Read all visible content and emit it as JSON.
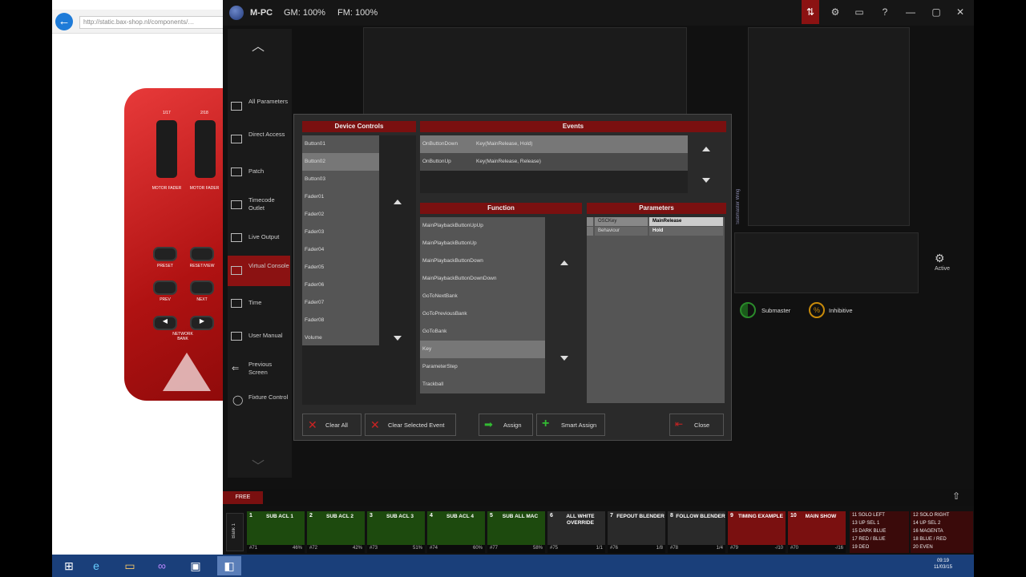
{
  "browser": {
    "url": "http://static.bax-shop.nl/components/…",
    "device_labels": {
      "fader1": "1/17",
      "fader2": "2/18",
      "fader1_label": "MOTOR FADER",
      "fader2_label": "MOTOR FADER",
      "pad1": "PRESET",
      "pad2": "RESET/VIEW",
      "pad3": "PREV",
      "pad4": "NEXT",
      "transport_label": "NETWORK BANK"
    }
  },
  "app": {
    "title": "M-PC",
    "gm": "GM: 100%",
    "fm": "FM: 100%",
    "window_buttons": [
      "⚙",
      "▭",
      "?",
      "—",
      "▢",
      "✕"
    ]
  },
  "sidemenu": {
    "items": [
      {
        "label": "All Parameters",
        "icon": "parameters-icon"
      },
      {
        "label": "Direct Access",
        "icon": "direct-access-icon"
      },
      {
        "label": "Patch",
        "icon": "patch-icon"
      },
      {
        "label": "Timecode Outlet",
        "icon": "timecode-icon"
      },
      {
        "label": "Live Output",
        "icon": "live-output-icon"
      },
      {
        "label": "Virtual Console",
        "icon": "virtual-console-icon"
      },
      {
        "label": "Time",
        "icon": "time-icon"
      },
      {
        "label": "User Manual",
        "icon": "manual-icon"
      },
      {
        "label": "Previous Screen",
        "icon": "arrow-left-icon"
      },
      {
        "label": "Fixture Control",
        "icon": "bulb-icon"
      }
    ],
    "active_index": 5
  },
  "dialog": {
    "device_controls_header": "Device Controls",
    "device_controls": [
      "Button01",
      "Button02",
      "Button03",
      "Fader01",
      "Fader02",
      "Fader03",
      "Fader04",
      "Fader05",
      "Fader06",
      "Fader07",
      "Fader08",
      "Volume"
    ],
    "selected_device_control": 1,
    "events_header": "Events",
    "events": [
      {
        "event": "OnButtonDown",
        "action": "Key(MainRelease, Hold)"
      },
      {
        "event": "OnButtonUp",
        "action": "Key(MainRelease, Release)"
      }
    ],
    "selected_event": 0,
    "function_header": "Function",
    "functions": [
      "MainPlaybackButtonUpUp",
      "MainPlaybackButtonUp",
      "MainPlaybackButtonDown",
      "MainPlaybackButtonDownDown",
      "GoToNextBank",
      "GoToPreviousBank",
      "GoToBank",
      "Key",
      "ParameterStep",
      "Trackball"
    ],
    "selected_function": 7,
    "parameters_header": "Parameters",
    "parameters": [
      {
        "name": "OSCKey",
        "value": "MainRelease"
      },
      {
        "name": "Behaviour",
        "value": "Hold"
      }
    ],
    "buttons": {
      "clear_all": "Clear All",
      "clear_selected": "Clear Selected Event",
      "assign": "Assign",
      "smart_assign": "Smart Assign",
      "close": "Close"
    }
  },
  "right_panel": {
    "active_label": "Active",
    "submaster_label": "Submaster",
    "inhibitive_label": "Inhibitive",
    "wing_label": "Submaster Wing"
  },
  "playback": {
    "free_label": "FREE",
    "bank_label": "Bank 1",
    "keys": [
      {
        "num": "1",
        "name": "SUB ACL 1",
        "cue": "#71",
        "pct": "46%",
        "style": "green"
      },
      {
        "num": "2",
        "name": "SUB ACL 2",
        "cue": "#72",
        "pct": "42%",
        "style": "green"
      },
      {
        "num": "3",
        "name": "SUB ACL 3",
        "cue": "#73",
        "pct": "51%",
        "style": "green"
      },
      {
        "num": "4",
        "name": "SUB ACL 4",
        "cue": "#74",
        "pct": "60%",
        "style": "green"
      },
      {
        "num": "5",
        "name": "SUB ALL MAC",
        "cue": "#77",
        "pct": "58%",
        "style": "green"
      },
      {
        "num": "6",
        "name": "ALL WHITE OVERRIDE",
        "cue": "#75",
        "pct": "1/1",
        "style": "dark"
      },
      {
        "num": "7",
        "name": "FEPOUT BLENDER",
        "cue": "#76",
        "pct": "1/8",
        "style": "dark"
      },
      {
        "num": "8",
        "name": "FOLLOW BLENDER",
        "cue": "#78",
        "pct": "1/4",
        "style": "dark"
      },
      {
        "num": "9",
        "name": "TIMING EXAMPLE",
        "cue": "#79",
        "pct": "-/10",
        "style": "red"
      },
      {
        "num": "10",
        "name": "MAIN SHOW",
        "cue": "#70",
        "pct": "-/16",
        "style": "red"
      }
    ],
    "cue_list_left": [
      "11 SOLO LEFT",
      "13 UP SEL 1",
      "15 DARK BLUE",
      "17 RED / BLUE",
      "19 DEO"
    ],
    "cue_list_right": [
      "12 SOLO RIGHT",
      "14 UP SEL 2",
      "16 MAGENTA",
      "18 BLUE / RED",
      "20 EVEN"
    ]
  },
  "taskbar": {
    "clock_time": "09:19",
    "clock_date": "11/03/15"
  }
}
